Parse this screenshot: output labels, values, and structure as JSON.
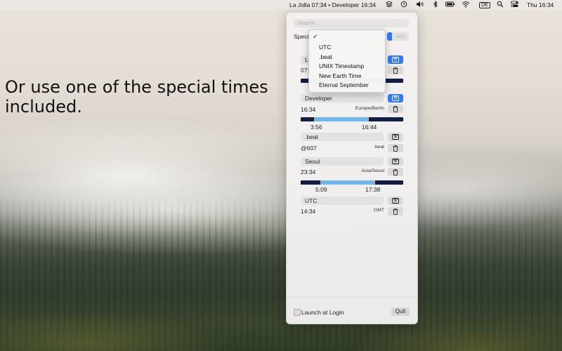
{
  "menubar": {
    "clock_label": "La Jolla 07:34 • Developer 16:34",
    "lang": "DE",
    "datetime": "Thu 16:34",
    "icons": [
      "stack-icon",
      "history-icon",
      "volume-icon",
      "bluetooth-icon",
      "wifi-icon",
      "search-icon",
      "control-center-icon"
    ]
  },
  "headline": "Or use one of the special times included.",
  "panel": {
    "search_placeholder": "Search...",
    "special_label": "Special",
    "add_label": "Add",
    "clocks": [
      {
        "name": "La",
        "time": "07:"
      },
      {
        "name": "Developer",
        "time": "16:34",
        "zone": "Europe/Berlin",
        "start": "3:56",
        "end": "16:44",
        "day_start": 0.13,
        "day_end": 0.66
      },
      {
        "name": ".beat",
        "time": "@607",
        "zone": ".beat"
      },
      {
        "name": "Seoul",
        "time": "23:34",
        "zone": "Asia/Seoul",
        "start": "5:09",
        "end": "17:38",
        "day_start": 0.19,
        "day_end": 0.72
      },
      {
        "name": "UTC",
        "time": "14:34",
        "zone": "GMT"
      }
    ],
    "launch_label": "Launch at Login",
    "quit_label": "Quit"
  },
  "dropdown": {
    "selected_mark": "✓",
    "options": [
      "UTC",
      ".beat",
      "UNIX Timestamp",
      "New Earth Time",
      "Eternal September"
    ]
  },
  "colors": {
    "accent": "#2f7bf5",
    "night": "#0f1d47",
    "day": "#6fb7ef",
    "sun": "#e3a43a"
  }
}
